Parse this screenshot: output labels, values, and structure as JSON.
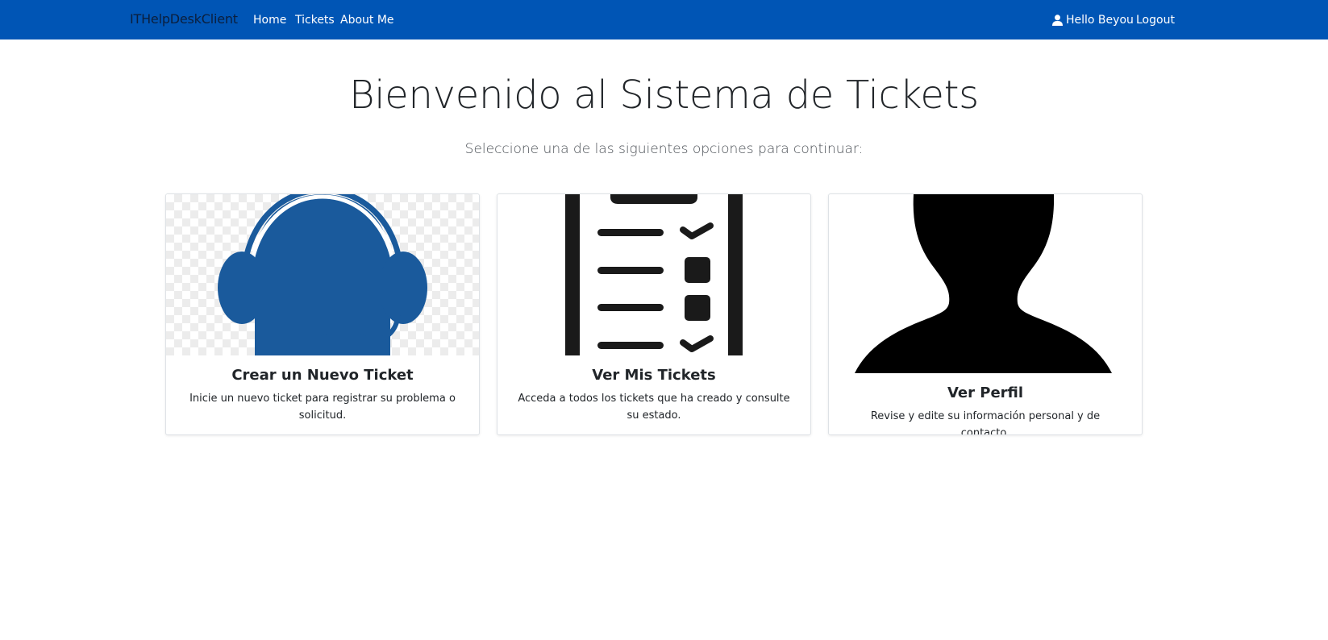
{
  "navbar": {
    "brand": "ITHelpDeskClient",
    "links": [
      {
        "label": "Home"
      },
      {
        "label": "Tickets"
      },
      {
        "label": "About Me"
      }
    ],
    "user_greeting": "Hello Beyou",
    "user_icon": "user-icon",
    "logout_label": "Logout",
    "background_color": "#0055b5"
  },
  "hero": {
    "title": "Bienvenido al Sistema de Tickets",
    "subtitle": "Seleccione una de las siguientes opciones para continuar:"
  },
  "cards": [
    {
      "icon": "headset-support-icon",
      "title": "Crear un Nuevo Ticket",
      "text": "Inicie un nuevo ticket para registrar su problema o solicitud.",
      "icon_color": "#1a5a9c"
    },
    {
      "icon": "checklist-icon",
      "title": "Ver Mis Tickets",
      "text": "Acceda a todos los tickets que ha creado y consulte su estado.",
      "icon_color": "#1a1a1a"
    },
    {
      "icon": "profile-silhouette-icon",
      "title": "Ver Perfil",
      "text": "Revise y edite su información personal y de contacto.",
      "icon_color": "#000000"
    }
  ]
}
